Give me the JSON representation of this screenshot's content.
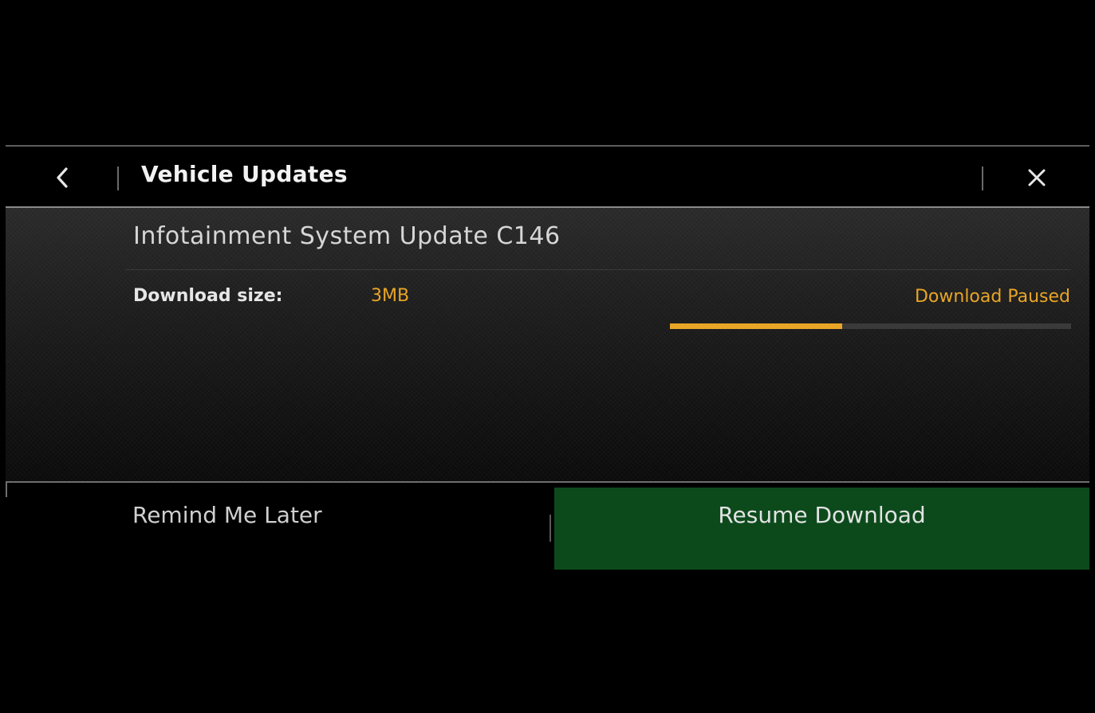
{
  "header": {
    "title": "Vehicle Updates",
    "back_icon": "chevron-left-icon",
    "close_icon": "close-icon"
  },
  "update": {
    "name": "Infotainment System Update C146",
    "size_label": "Download size:",
    "size_value": "3MB",
    "status": "Download Paused",
    "progress_fraction": 0.43
  },
  "actions": {
    "remind_label": "Remind Me Later",
    "resume_label": "Resume Download"
  },
  "colors": {
    "accent": "#e8a526",
    "primary_button": "#0c4a1c",
    "background": "#000000"
  }
}
